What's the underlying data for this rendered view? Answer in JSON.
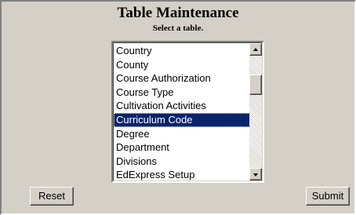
{
  "page": {
    "title": "Table Maintenance",
    "subtitle": "Select a table."
  },
  "table_list": {
    "items": [
      "Country",
      "County",
      "Course Authorization",
      "Course Type",
      "Cultivation Activities",
      "Curriculum Code",
      "Degree",
      "Department",
      "Divisions",
      "EdExpress Setup"
    ],
    "selected": "Curriculum Code"
  },
  "buttons": {
    "reset_label": "Reset",
    "submit_label": "Submit"
  },
  "colors": {
    "background": "#d4d0c8",
    "selection": "#0a246a",
    "selection_text": "#ffffff"
  },
  "icons": {
    "scroll_up": "arrow-up-icon",
    "scroll_down": "arrow-down-icon"
  }
}
